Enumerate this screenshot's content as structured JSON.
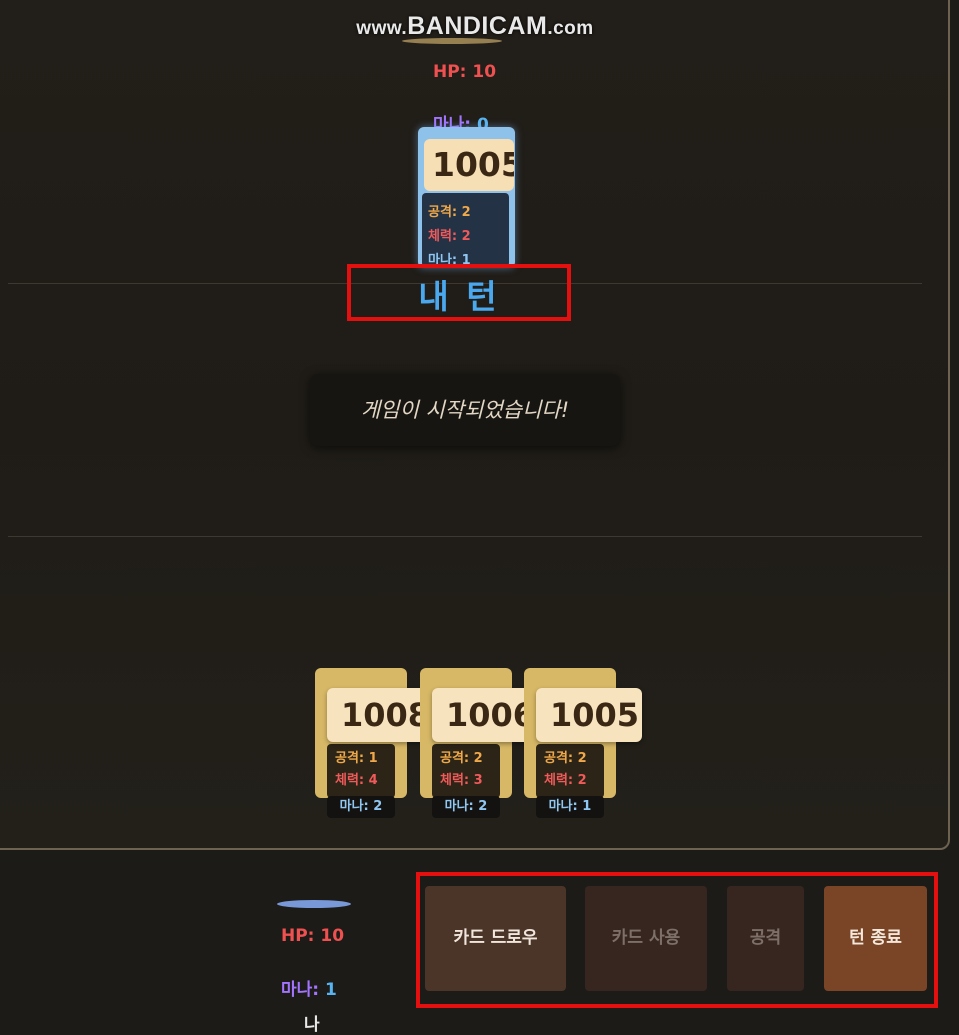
{
  "watermark": {
    "prefix": "www.",
    "brand": "BANDICAM",
    "suffix": ".com"
  },
  "opponent": {
    "hp_label": "HP: 10",
    "mana_label": "마나:",
    "mana_value": "0",
    "field_card": {
      "id": "1005",
      "attack": "공격: 2",
      "health": "체력: 2",
      "mana": "마나: 1"
    }
  },
  "turn_indicator": "내 턴",
  "toast": "게임이 시작되었습니다!",
  "hand": [
    {
      "id": "1008",
      "attack": "공격: 1",
      "health": "체력: 4",
      "mana": "마나: 2"
    },
    {
      "id": "1006",
      "attack": "공격: 2",
      "health": "체력: 3",
      "mana": "마나: 2"
    },
    {
      "id": "1005",
      "attack": "공격: 2",
      "health": "체력: 2",
      "mana": "마나: 1"
    }
  ],
  "player": {
    "hp_label": "HP: 10",
    "mana_label": "마나:",
    "mana_value": "1",
    "name": "나"
  },
  "actions": {
    "draw": "카드 드로우",
    "use": "카드 사용",
    "attack": "공격",
    "end_turn": "턴 종료"
  },
  "colors": {
    "turn_text": "#4aa8ef",
    "highlight_box": "#e41010",
    "hp": "#ef5050",
    "mana": "#a274ff"
  }
}
